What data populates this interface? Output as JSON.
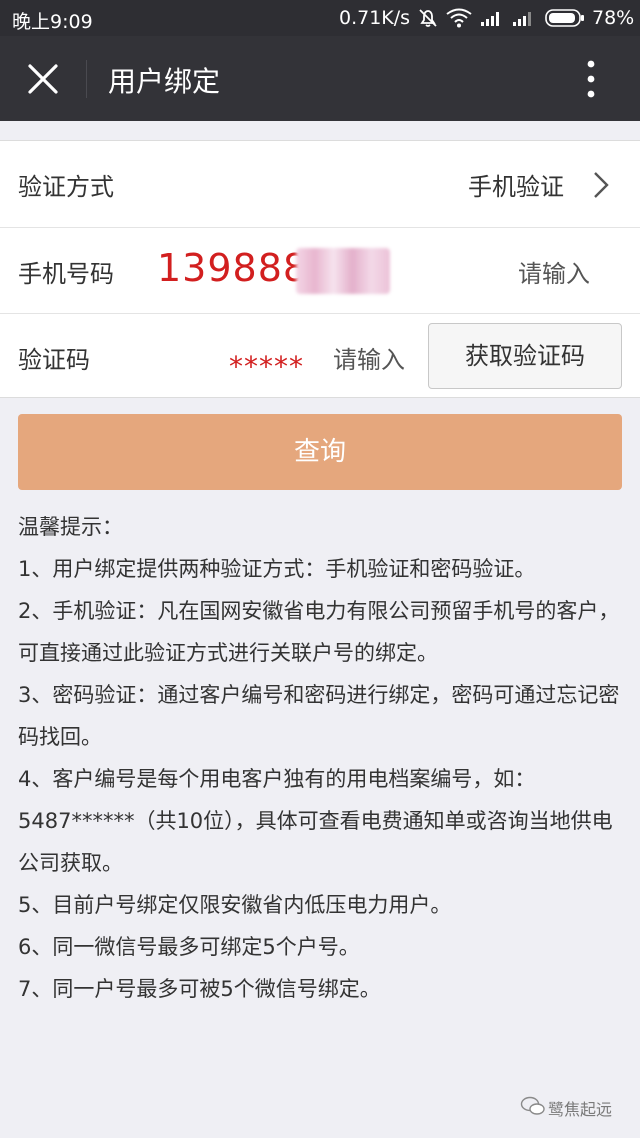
{
  "status_bar": {
    "time": "晚上9:09",
    "speed": "0.71K/s",
    "battery_pct": "78%",
    "icons": [
      "mute-icon",
      "wifi-icon",
      "signal-icon",
      "signal-icon",
      "battery-icon"
    ]
  },
  "nav": {
    "title": "用户绑定",
    "close_icon": "close-icon",
    "more_icon": "more-vertical-icon"
  },
  "form": {
    "verify_method": {
      "label": "验证方式",
      "value": "手机验证"
    },
    "phone": {
      "label": "手机号码",
      "value": "139888",
      "placeholder": "请输入"
    },
    "code": {
      "label": "验证码",
      "value": "*****",
      "placeholder": "请输入",
      "button": "获取验证码"
    }
  },
  "query_button": "查询",
  "tips": {
    "title": "温馨提示：",
    "items": [
      "1、用户绑定提供两种验证方式：手机验证和密码验证。",
      "2、手机验证：凡在国网安徽省电力有限公司预留手机号的客户，可直接通过此验证方式进行关联户号的绑定。",
      "3、密码验证：通过客户编号和密码进行绑定，密码可通过忘记密码找回。",
      "4、客户编号是每个用电客户独有的用电档案编号，如：5487******（共10位），具体可查看电费通知单或咨询当地供电公司获取。",
      "5、目前户号绑定仅限安徽省内低压电力用户。",
      "6、同一微信号最多可绑定5个户号。",
      "7、同一户号最多可被5个微信号绑定。"
    ]
  },
  "watermark": "鹭焦起远",
  "colors": {
    "nav_bg": "#333338",
    "accent_orange": "#e5a77d",
    "highlight_red": "#d21f1f",
    "page_bg": "#efeff4"
  }
}
